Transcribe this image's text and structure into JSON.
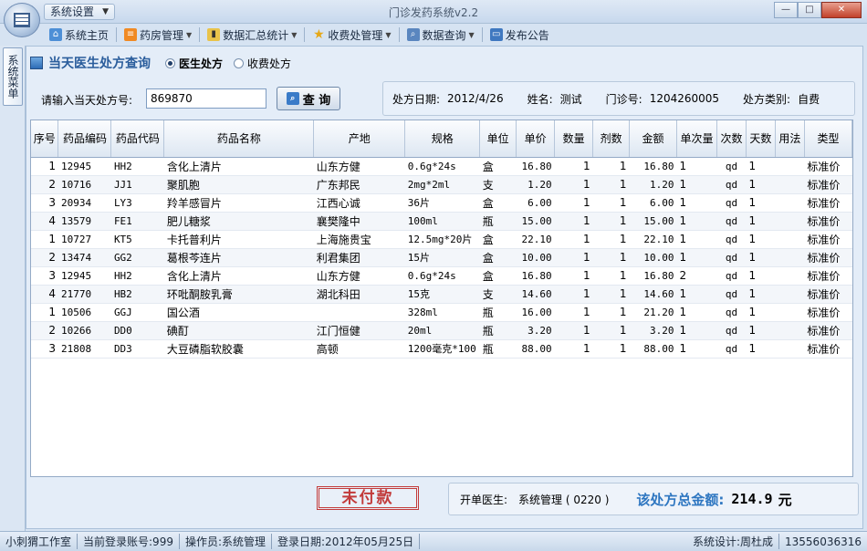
{
  "window": {
    "app_title": "门诊发药系统v2.2",
    "system_menu": "系统设置"
  },
  "toolbar": {
    "items": [
      {
        "label": "系统主页",
        "icon": "home-icon",
        "dropdown": false
      },
      {
        "label": "药房管理",
        "icon": "pharmacy-icon",
        "dropdown": true
      },
      {
        "label": "数据汇总统计",
        "icon": "chart-icon",
        "dropdown": true
      },
      {
        "label": "收费处管理",
        "icon": "star-icon",
        "dropdown": true
      },
      {
        "label": "数据查询",
        "icon": "search-icon",
        "dropdown": true
      },
      {
        "label": "发布公告",
        "icon": "announce-icon",
        "dropdown": false
      }
    ]
  },
  "side_tab": "系统菜单",
  "panel": {
    "title": "当天医生处方查询",
    "radio_doctor": "医生处方",
    "radio_charge": "收费处方",
    "query_label": "请输入当天处方号:",
    "query_value": "869870",
    "query_button": "查 询"
  },
  "info": {
    "date_label": "处方日期:",
    "date_value": "2012/4/26",
    "name_label": "姓名:",
    "name_value": "测试",
    "clinic_label": "门诊号:",
    "clinic_value": "1204260005",
    "type_label": "处方类别:",
    "type_value": "自费"
  },
  "table": {
    "headers": [
      "序号",
      "药品编码",
      "药品代码",
      "药品名称",
      "产地",
      "规格",
      "单位",
      "单价",
      "数量",
      "剂数",
      "金额",
      "单次量",
      "次数",
      "天数",
      "用法",
      "类型"
    ],
    "rows": [
      [
        "1",
        "12945",
        "HH2",
        "含化上清片",
        "山东方健",
        "0.6g*24s",
        "盒",
        "16.80",
        "1",
        "1",
        "16.80",
        "1",
        "qd",
        "1",
        "",
        "标准价"
      ],
      [
        "2",
        "10716",
        "JJ1",
        "聚肌胞",
        "广东邦民",
        "2mg*2ml",
        "支",
        "1.20",
        "1",
        "1",
        "1.20",
        "1",
        "qd",
        "1",
        "",
        "标准价"
      ],
      [
        "3",
        "20934",
        "LY3",
        "羚羊感冒片",
        "江西心诚",
        "36片",
        "盒",
        "6.00",
        "1",
        "1",
        "6.00",
        "1",
        "qd",
        "1",
        "",
        "标准价"
      ],
      [
        "4",
        "13579",
        "FE1",
        "肥儿糖浆",
        "襄樊隆中",
        "100ml",
        "瓶",
        "15.00",
        "1",
        "1",
        "15.00",
        "1",
        "qd",
        "1",
        "",
        "标准价"
      ],
      [
        "1",
        "10727",
        "KT5",
        "卡托普利片",
        "上海施贵宝",
        "12.5mg*20片",
        "盒",
        "22.10",
        "1",
        "1",
        "22.10",
        "1",
        "qd",
        "1",
        "",
        "标准价"
      ],
      [
        "2",
        "13474",
        "GG2",
        "葛根芩连片",
        "利君集团",
        "15片",
        "盒",
        "10.00",
        "1",
        "1",
        "10.00",
        "1",
        "qd",
        "1",
        "",
        "标准价"
      ],
      [
        "3",
        "12945",
        "HH2",
        "含化上清片",
        "山东方健",
        "0.6g*24s",
        "盒",
        "16.80",
        "1",
        "1",
        "16.80",
        "2",
        "qd",
        "1",
        "",
        "标准价"
      ],
      [
        "4",
        "21770",
        "HB2",
        "环吡酮胺乳膏",
        "湖北科田",
        "15克",
        "支",
        "14.60",
        "1",
        "1",
        "14.60",
        "1",
        "qd",
        "1",
        "",
        "标准价"
      ],
      [
        "1",
        "10506",
        "GGJ",
        "国公酒",
        "",
        "328ml",
        "瓶",
        "16.00",
        "1",
        "1",
        "21.20",
        "1",
        "qd",
        "1",
        "",
        "标准价"
      ],
      [
        "2",
        "10266",
        "DD0",
        "碘酊",
        "江门恒健",
        "20ml",
        "瓶",
        "3.20",
        "1",
        "1",
        "3.20",
        "1",
        "qd",
        "1",
        "",
        "标准价"
      ],
      [
        "3",
        "21808",
        "DD3",
        "大豆磷脂软胶囊",
        "高顿",
        "1200毫克*100",
        "瓶",
        "88.00",
        "1",
        "1",
        "88.00",
        "1",
        "qd",
        "1",
        "",
        "标准价"
      ]
    ]
  },
  "footer": {
    "stamp": "未付款",
    "doctor_label": "开单医生:",
    "doctor_value": "系统管理 ( 0220 )",
    "total_label": "该处方总金额:",
    "total_value": "214.9",
    "total_unit": "元"
  },
  "status": {
    "studio": "小刺猬工作室",
    "account": "当前登录账号:999",
    "operator": "操作员:系统管理",
    "login_date": "登录日期:2012年05月25日",
    "designer": "系统设计:周杜成",
    "phone": "13556036316"
  }
}
